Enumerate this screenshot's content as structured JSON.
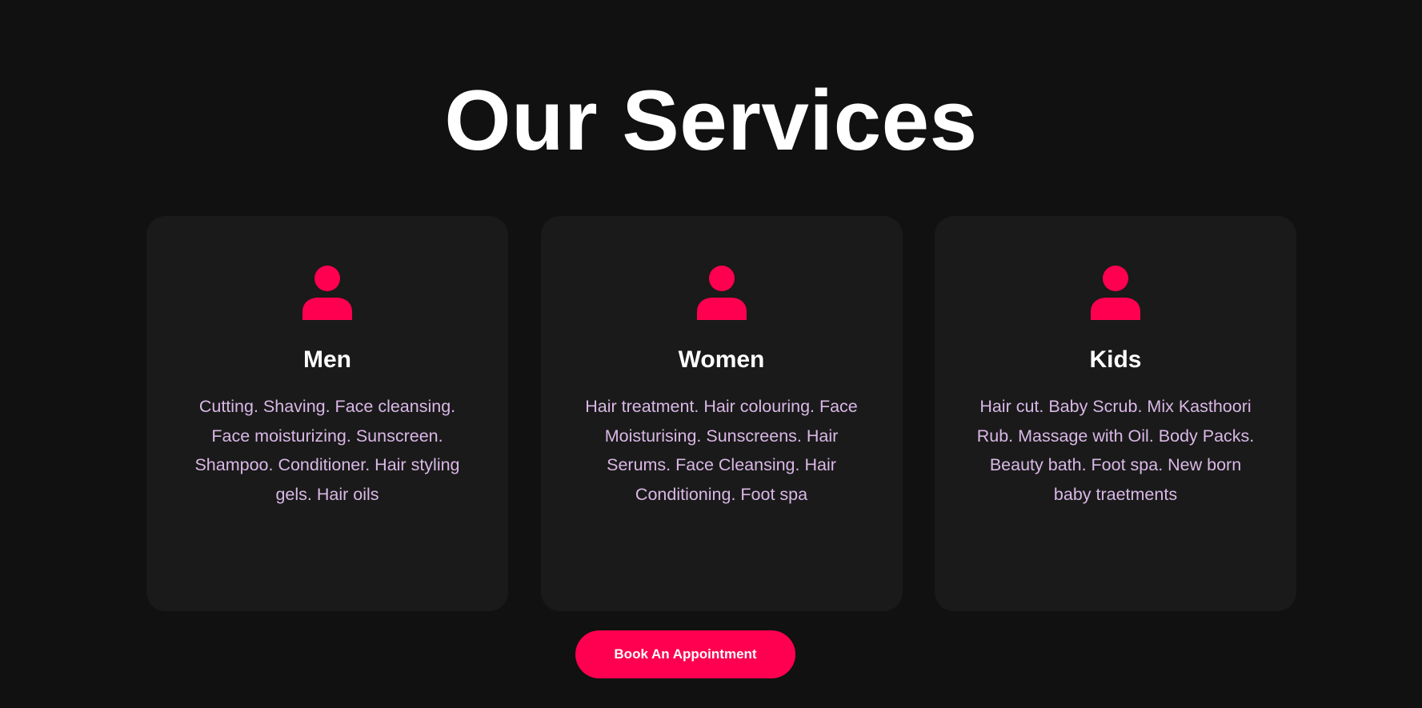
{
  "section": {
    "title": "Our Services"
  },
  "cards": [
    {
      "icon": "user-icon",
      "title": "Men",
      "text": "Cutting. Shaving. Face cleansing. Face moisturizing. Sunscreen. Shampoo. Conditioner. Hair styling gels. Hair oils"
    },
    {
      "icon": "user-icon",
      "title": "Women",
      "text": "Hair treatment. Hair colouring. Face Moisturising. Sunscreens. Hair Serums. Face Cleansing. Hair Conditioning. Foot spa"
    },
    {
      "icon": "user-icon",
      "title": "Kids",
      "text": "Hair cut. Baby Scrub. Mix Kasthoori Rub. Massage with Oil. Body Packs. Beauty bath. Foot spa. New born baby traetments"
    }
  ],
  "cta": {
    "label": "Book An Appointment"
  },
  "colors": {
    "background": "#111111",
    "card": "#1a1a1a",
    "accent": "#ff0050",
    "body_text": "#d9b8e6",
    "heading": "#ffffff"
  }
}
